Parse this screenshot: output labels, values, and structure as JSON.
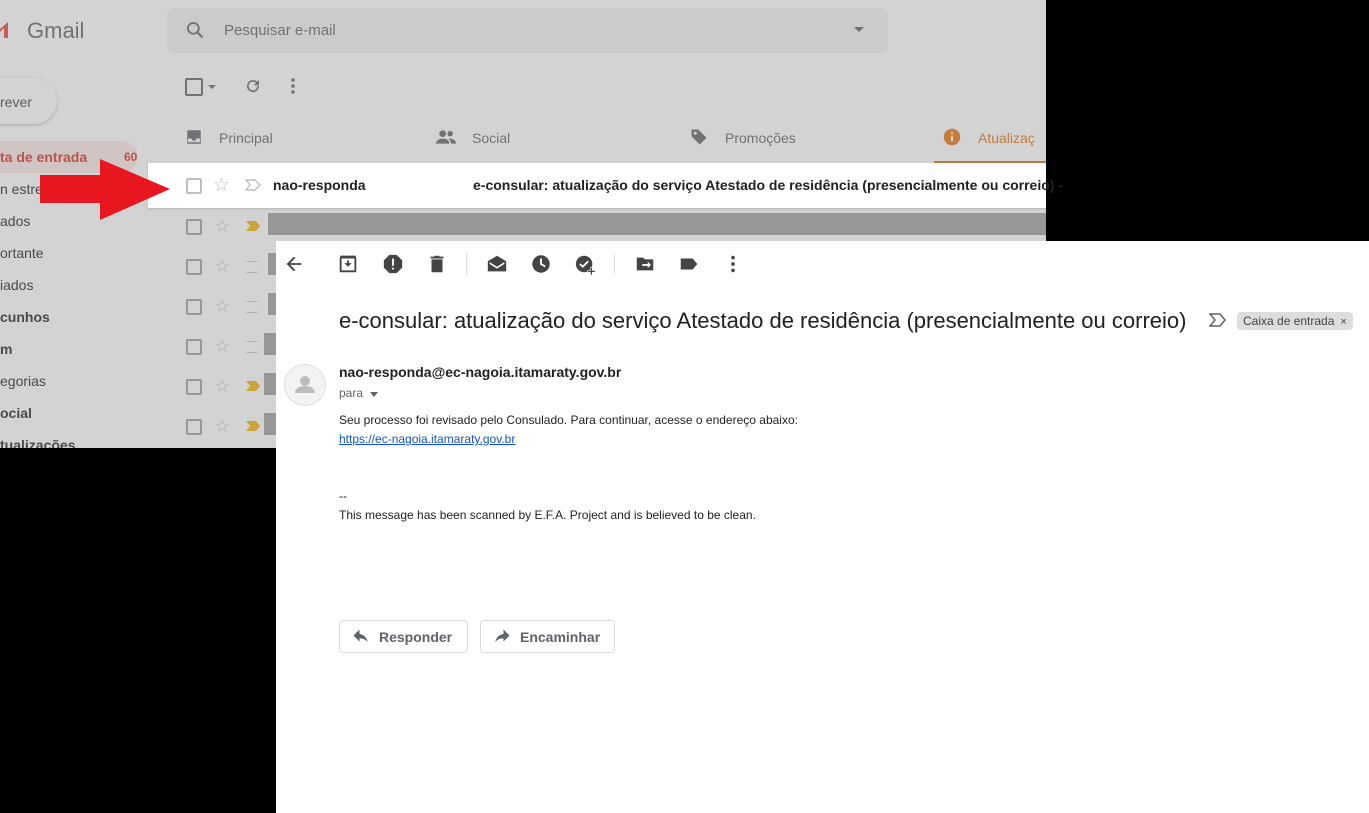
{
  "app": {
    "name": "Gmail"
  },
  "search": {
    "placeholder": "Pesquisar e-mail"
  },
  "compose": {
    "label": "Escrever",
    "visible_label": "rever"
  },
  "sidebar": {
    "items": [
      {
        "label": "ta de entrada",
        "count": "60",
        "active": true
      },
      {
        "label": "n estre"
      },
      {
        "label": "ados"
      },
      {
        "label": "ortante"
      },
      {
        "label": "iados"
      },
      {
        "label": "cunhos",
        "bold": true
      },
      {
        "label": "m",
        "bold": true
      },
      {
        "label": "egorias"
      },
      {
        "label": "ocial",
        "bold": true
      },
      {
        "label": "tualizações",
        "bold": true
      }
    ]
  },
  "tabs": [
    {
      "label": "Principal",
      "icon": "inbox-icon"
    },
    {
      "label": "Social",
      "icon": "people-icon"
    },
    {
      "label": "Promoções",
      "icon": "tag-icon"
    },
    {
      "label": "Atualizaç",
      "icon": "info-icon",
      "active": true,
      "color": "#e8710a"
    }
  ],
  "inbox_row": {
    "sender": "nao-responda",
    "subject": "e-consular: atualização do serviço Atestado de residência (presencialmente ou correio) -"
  },
  "annotation": {
    "arrow": "red-arrow",
    "color": "#e8161e"
  },
  "email": {
    "subject": "e-consular: atualização do serviço Atestado de residência (presencialmente ou correio)",
    "label_chip": "Caixa de entrada",
    "label_remove": "×",
    "from": "nao-responda@ec-nagoia.itamaraty.gov.br",
    "to_label": "para",
    "body_line1": "Seu processo foi revisado pelo Consulado. Para continuar, acesse o endereço abaixo:",
    "link": "https://ec-nagoia.itamaraty.gov.br",
    "signature_sep": "--",
    "footer": "This message has been scanned by E.F.A. Project and is believed to be clean."
  },
  "actions": {
    "reply": "Responder",
    "forward": "Encaminhar"
  },
  "toolbar_icons": [
    "back-arrow-icon",
    "archive-icon",
    "report-spam-icon",
    "delete-icon",
    "mark-unread-icon",
    "snooze-icon",
    "add-task-icon",
    "move-to-icon",
    "label-icon",
    "more-vert-icon"
  ]
}
